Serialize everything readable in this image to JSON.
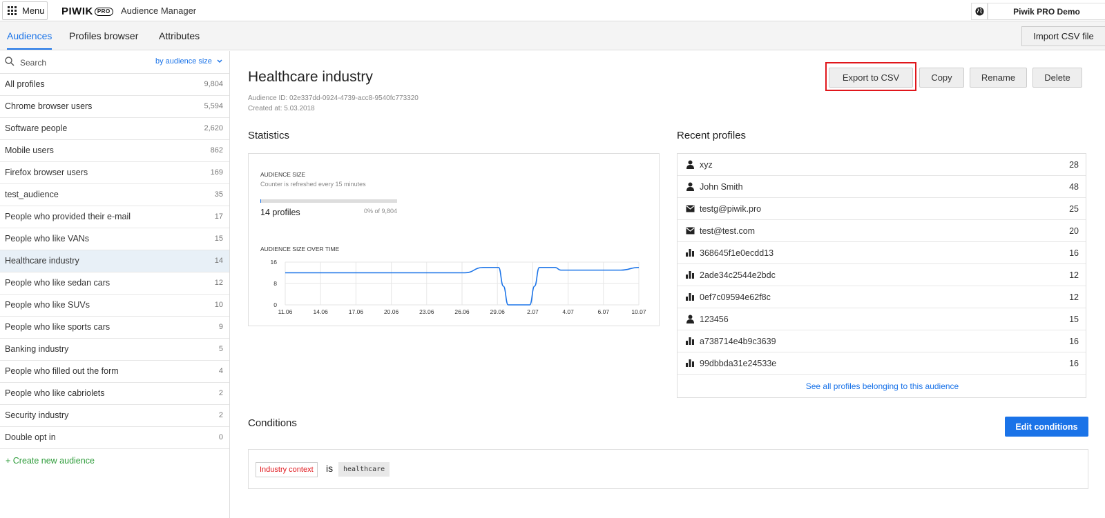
{
  "topbar": {
    "menu_label": "Menu",
    "logo_text": "PIWIK",
    "logo_badge": "PRO",
    "app_name": "Audience Manager",
    "account_name": "Piwik PRO Demo"
  },
  "tabs": [
    "Audiences",
    "Profiles browser",
    "Attributes"
  ],
  "import_label": "Import CSV file",
  "sidebar": {
    "search_placeholder": "Search",
    "sort_label": "by audience size",
    "audiences": [
      {
        "name": "All profiles",
        "count": "9,804"
      },
      {
        "name": "Chrome browser users",
        "count": "5,594"
      },
      {
        "name": "Software people",
        "count": "2,620"
      },
      {
        "name": "Mobile users",
        "count": "862"
      },
      {
        "name": "Firefox browser users",
        "count": "169"
      },
      {
        "name": "test_audience",
        "count": "35"
      },
      {
        "name": "People who provided their e-mail",
        "count": "17"
      },
      {
        "name": "People who like VANs",
        "count": "15"
      },
      {
        "name": "Healthcare industry",
        "count": "14"
      },
      {
        "name": "People who like sedan cars",
        "count": "12"
      },
      {
        "name": "People who like SUVs",
        "count": "10"
      },
      {
        "name": "People who like sports cars",
        "count": "9"
      },
      {
        "name": "Banking industry",
        "count": "5"
      },
      {
        "name": "People who filled out the form",
        "count": "4"
      },
      {
        "name": "People who like cabriolets",
        "count": "2"
      },
      {
        "name": "Security industry",
        "count": "2"
      },
      {
        "name": "Double opt in",
        "count": "0"
      }
    ],
    "selected_index": 8,
    "create_label": "+ Create new audience"
  },
  "detail": {
    "title": "Healthcare industry",
    "audience_id": "Audience ID: 02e337dd-0924-4739-acc8-9540fc773320",
    "created_at": "Created at: 5.03.2018",
    "buttons": {
      "export": "Export to CSV",
      "copy": "Copy",
      "rename": "Rename",
      "delete": "Delete"
    }
  },
  "statistics": {
    "heading": "Statistics",
    "size_label": "AUDIENCE SIZE",
    "refresh_note": "Counter is refreshed every 15 minutes",
    "profiles_text": "14 profiles",
    "percent_text": "0% of 9,804",
    "size_fraction": 0.0014,
    "over_time_label": "AUDIENCE SIZE OVER TIME"
  },
  "chart_data": {
    "type": "line",
    "title": "AUDIENCE SIZE OVER TIME",
    "x_ticks": [
      "11.06",
      "14.06",
      "17.06",
      "20.06",
      "23.06",
      "26.06",
      "29.06",
      "2.07",
      "4.07",
      "6.07",
      "10.07"
    ],
    "y_ticks": [
      0,
      8,
      16
    ],
    "ylim": [
      0,
      16
    ],
    "xlim": [
      0,
      29.5
    ],
    "line_color": "#1a73e8",
    "series": [
      {
        "x": [
          0,
          15,
          16.5,
          17.8,
          18.2,
          18.6,
          20.4,
          20.8,
          21.2,
          22.5,
          23,
          24,
          25,
          26,
          28,
          29.5
        ],
        "values": [
          12,
          12,
          14,
          14,
          7,
          0,
          0,
          7,
          14,
          14,
          13,
          13,
          13,
          13,
          13,
          14
        ]
      }
    ]
  },
  "recent": {
    "heading": "Recent profiles",
    "profiles": [
      {
        "icon": "user-icon",
        "name": "xyz",
        "count": "28"
      },
      {
        "icon": "user-icon",
        "name": "John Smith",
        "count": "48"
      },
      {
        "icon": "envelope-icon",
        "name": "testg@piwik.pro",
        "count": "25"
      },
      {
        "icon": "envelope-icon",
        "name": "test@test.com",
        "count": "20"
      },
      {
        "icon": "bar-chart-icon",
        "name": "368645f1e0ecdd13",
        "count": "16"
      },
      {
        "icon": "bar-chart-icon",
        "name": "2ade34c2544e2bdc",
        "count": "12"
      },
      {
        "icon": "bar-chart-icon",
        "name": "0ef7c09594e62f8c",
        "count": "12"
      },
      {
        "icon": "user-icon",
        "name": "123456",
        "count": "15"
      },
      {
        "icon": "bar-chart-icon",
        "name": "a738714e4b9c3639",
        "count": "16"
      },
      {
        "icon": "bar-chart-icon",
        "name": "99dbbda31e24533e",
        "count": "16"
      }
    ],
    "see_all": "See all profiles belonging to this audience"
  },
  "conditions": {
    "heading": "Conditions",
    "edit_label": "Edit conditions",
    "attribute": "Industry context",
    "operator": "is",
    "value": "healthcare"
  },
  "colors": {
    "accent": "#1a73e8",
    "highlight": "#e0161b",
    "create": "#2e9c3a"
  }
}
